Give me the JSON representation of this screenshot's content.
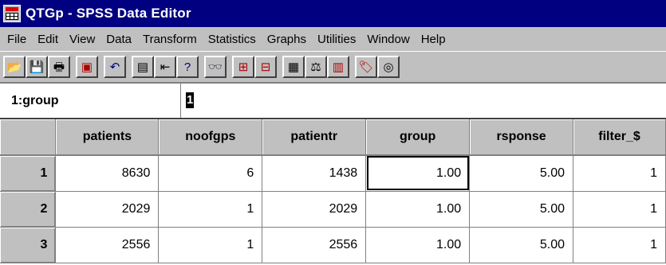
{
  "window": {
    "title": "QTGp - SPSS Data Editor"
  },
  "menu": [
    "File",
    "Edit",
    "View",
    "Data",
    "Transform",
    "Statistics",
    "Graphs",
    "Utilities",
    "Window",
    "Help"
  ],
  "toolbar": [
    {
      "icon": "open-folder-icon",
      "glyph": "📂"
    },
    {
      "icon": "save-disk-icon",
      "glyph": "💾"
    },
    {
      "icon": "print-icon",
      "glyph": "🖶"
    },
    {
      "icon": "dialog-recall-icon",
      "glyph": "▣"
    },
    {
      "icon": "undo-icon",
      "glyph": "↶"
    },
    {
      "icon": "goto-chart-icon",
      "glyph": "▤"
    },
    {
      "icon": "goto-case-icon",
      "glyph": "⇤"
    },
    {
      "icon": "variables-info-icon",
      "glyph": "?"
    },
    {
      "icon": "find-binoculars-icon",
      "glyph": "👓"
    },
    {
      "icon": "insert-case-icon",
      "glyph": "⊞"
    },
    {
      "icon": "insert-variable-icon",
      "glyph": "⊟"
    },
    {
      "icon": "split-file-icon",
      "glyph": "▦"
    },
    {
      "icon": "weight-cases-icon",
      "glyph": "⚖"
    },
    {
      "icon": "select-cases-icon",
      "glyph": "▥"
    },
    {
      "icon": "value-labels-icon",
      "glyph": "🏷"
    },
    {
      "icon": "use-sets-icon",
      "glyph": "◎"
    }
  ],
  "cell_editor": {
    "reference": "1:group",
    "value": "1"
  },
  "grid": {
    "columns": [
      "patients",
      "noofgps",
      "patientr",
      "group",
      "rsponse",
      "filter_$"
    ],
    "rows": [
      {
        "num": "1",
        "cells": [
          "8630",
          "6",
          "1438",
          "1.00",
          "5.00",
          "1"
        ]
      },
      {
        "num": "2",
        "cells": [
          "2029",
          "1",
          "2029",
          "1.00",
          "5.00",
          "1"
        ]
      },
      {
        "num": "3",
        "cells": [
          "2556",
          "1",
          "2556",
          "1.00",
          "5.00",
          "1"
        ]
      }
    ]
  }
}
